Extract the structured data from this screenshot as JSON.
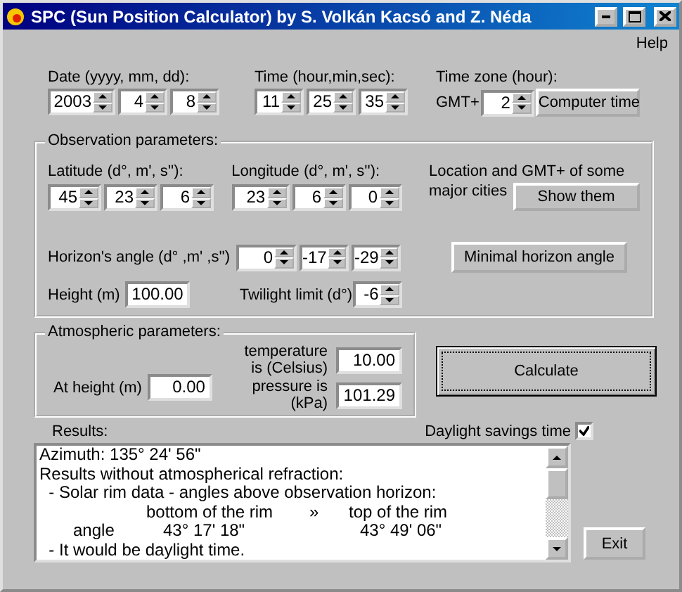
{
  "window": {
    "title": "SPC (Sun Position Calculator) by S. Volkán Kacsó and Z. Néda"
  },
  "menu": [
    "Help"
  ],
  "date": {
    "label": "Date (yyyy, mm, dd):",
    "fields": [
      "2003",
      "4",
      "8"
    ]
  },
  "time": {
    "label": "Time (hour,min,sec):",
    "fields": [
      "11",
      "25",
      "35"
    ]
  },
  "time_zone": {
    "label": "Time zone (hour):",
    "prefix": "GMT+",
    "value": "2",
    "button": "Computer time"
  },
  "observation": {
    "title": "Observation parameters:",
    "latitude": {
      "label": "Latitude (d°, m', s''):",
      "fields": [
        "45",
        "23",
        "6"
      ]
    },
    "longitude": {
      "label": "Longitude (d°, m', s''):",
      "fields": [
        "23",
        "6",
        "0"
      ]
    },
    "cities_note": [
      "Location and GMT+ of some",
      "major cities"
    ],
    "show_button": "Show them",
    "horizon": {
      "label": "Horizon's angle (d° ,m' ,s'')",
      "fields": [
        "0",
        "-17",
        "-29"
      ]
    },
    "horizon_button": "Minimal horizon angle",
    "height": {
      "label": "Height (m)",
      "value": "100.00"
    },
    "twilight": {
      "label": "Twilight limit (d°)",
      "value": "-6"
    }
  },
  "atmosphere": {
    "title": "Atmospheric parameters:",
    "height": {
      "label": "At height (m)",
      "value": "0.00"
    },
    "temperature": {
      "label": "temperature is (Celsius)",
      "value": "10.00"
    },
    "pressure": {
      "label": "pressure is (kPa)",
      "value": "101.29"
    }
  },
  "calculate_button": "Calculate",
  "results": {
    "label": "Results:",
    "daylight_savings": {
      "label": "Daylight savings time",
      "checked": true
    },
    "lines": [
      {
        "kind": "text",
        "text": "Azimuth: 135° 24' 56\""
      },
      {
        "kind": "text",
        "text": "Results without atmospherical refraction:"
      },
      {
        "kind": "text",
        "text": "  - Solar rim data - angles above observation horizon:"
      },
      {
        "kind": "header",
        "cells": [
          "bottom of the rim",
          "»",
          "top of the rim"
        ]
      },
      {
        "kind": "row",
        "cells": [
          "angle",
          "43° 17' 18\"",
          "43° 49' 06\""
        ]
      },
      {
        "kind": "text",
        "text": "  - It would be daylight time."
      }
    ]
  },
  "exit_button": "Exit"
}
